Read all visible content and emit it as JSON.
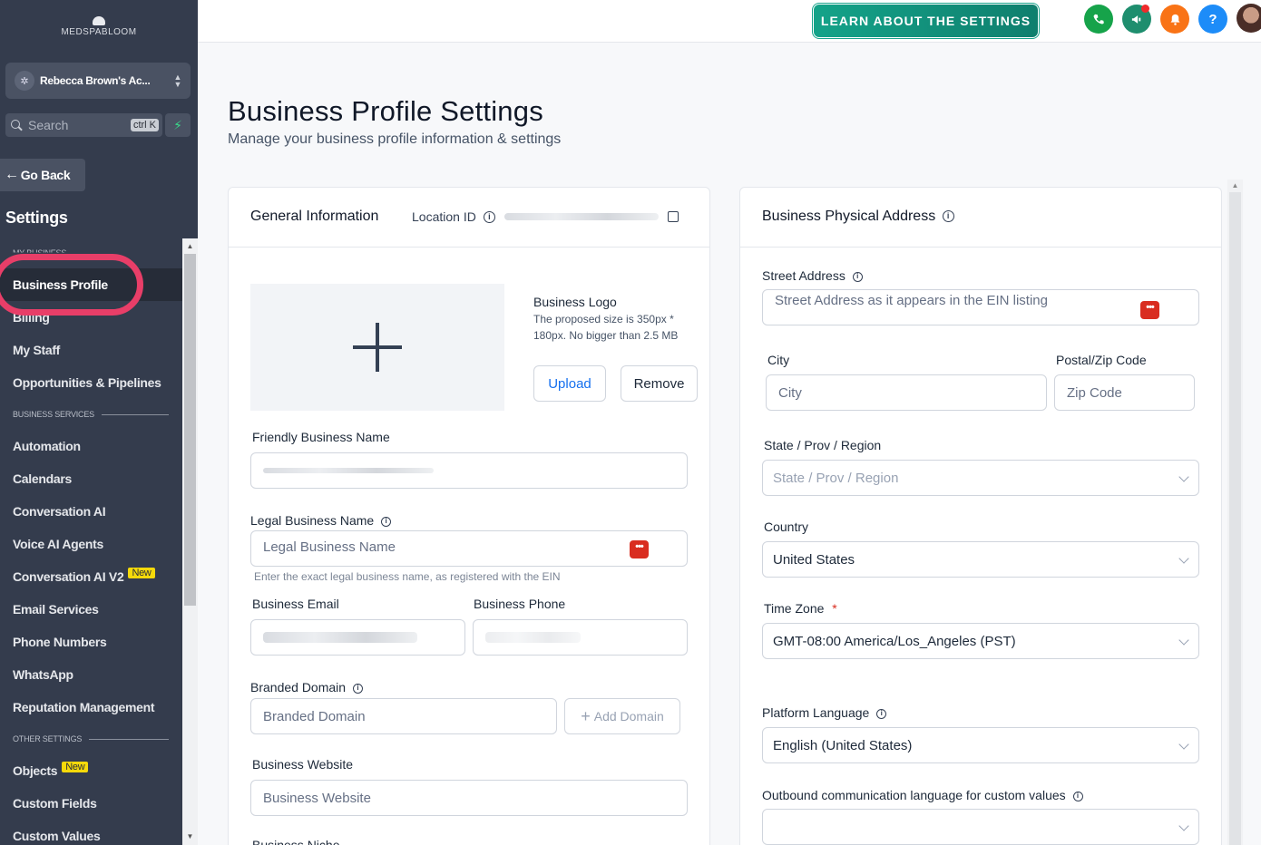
{
  "sidebar": {
    "logo_text": "MEDSPABLOOM",
    "account_name": "Rebecca Brown's Ac...",
    "search_placeholder": "Search",
    "search_shortcut": "ctrl K",
    "go_back": "Go Back",
    "settings_title": "Settings",
    "section_my_business": "MY BUSINESS",
    "section_business_services": "BUSINESS SERVICES",
    "section_other_settings": "OTHER SETTINGS",
    "items": {
      "business_profile": "Business Profile",
      "billing": "Billing",
      "my_staff": "My Staff",
      "opportunities": "Opportunities & Pipelines",
      "automation": "Automation",
      "calendars": "Calendars",
      "conversation_ai": "Conversation AI",
      "voice_ai": "Voice AI Agents",
      "conversation_ai_v2": "Conversation AI V2",
      "email_services": "Email Services",
      "phone_numbers": "Phone Numbers",
      "whatsapp": "WhatsApp",
      "reputation": "Reputation Management",
      "objects": "Objects",
      "custom_fields": "Custom Fields",
      "custom_values": "Custom Values"
    },
    "new_badge": "New",
    "active_item": "Business Profile"
  },
  "topbar": {
    "learn_button": "LEARN ABOUT THE SETTINGS",
    "icons": [
      "phone-icon",
      "megaphone-icon",
      "bell-icon",
      "help-icon",
      "user-avatar"
    ],
    "colors": {
      "phone": "#16a34a",
      "megaphone": "#1e8e6e",
      "bell": "#f97316",
      "help": "#1d8cf8"
    }
  },
  "page": {
    "title": "Business Profile Settings",
    "subtitle": "Manage your business profile information & settings"
  },
  "general": {
    "title": "General Information",
    "location_id_label": "Location ID",
    "logo_title": "Business Logo",
    "logo_hint_1": "The proposed size is 350px *",
    "logo_hint_2": "180px. No bigger than 2.5 MB",
    "upload": "Upload",
    "remove": "Remove",
    "friendly_name_label": "Friendly Business Name",
    "legal_name_label": "Legal Business Name",
    "legal_name_placeholder": "Legal Business Name",
    "legal_name_helper": "Enter the exact legal business name, as registered with the EIN",
    "email_label": "Business Email",
    "phone_label": "Business Phone",
    "branded_domain_label": "Branded Domain",
    "branded_domain_placeholder": "Branded Domain",
    "add_domain": "Add Domain",
    "website_label": "Business Website",
    "website_placeholder": "Business Website",
    "niche_label": "Business Niche"
  },
  "address": {
    "title": "Business Physical Address",
    "street_label": "Street Address",
    "street_placeholder": "Street Address as it appears in the EIN listing",
    "city_label": "City",
    "city_placeholder": "City",
    "zip_label": "Postal/Zip Code",
    "zip_placeholder": "Zip Code",
    "state_label": "State / Prov / Region",
    "state_placeholder": "State / Prov / Region",
    "country_label": "Country",
    "country_value": "United States",
    "timezone_label": "Time Zone",
    "required_mark": "*",
    "timezone_value": "GMT-08:00 America/Los_Angeles (PST)",
    "platform_language_label": "Platform Language",
    "platform_language_value": "English (United States)",
    "outbound_label": "Outbound communication language for custom values",
    "outbound_value": ""
  }
}
